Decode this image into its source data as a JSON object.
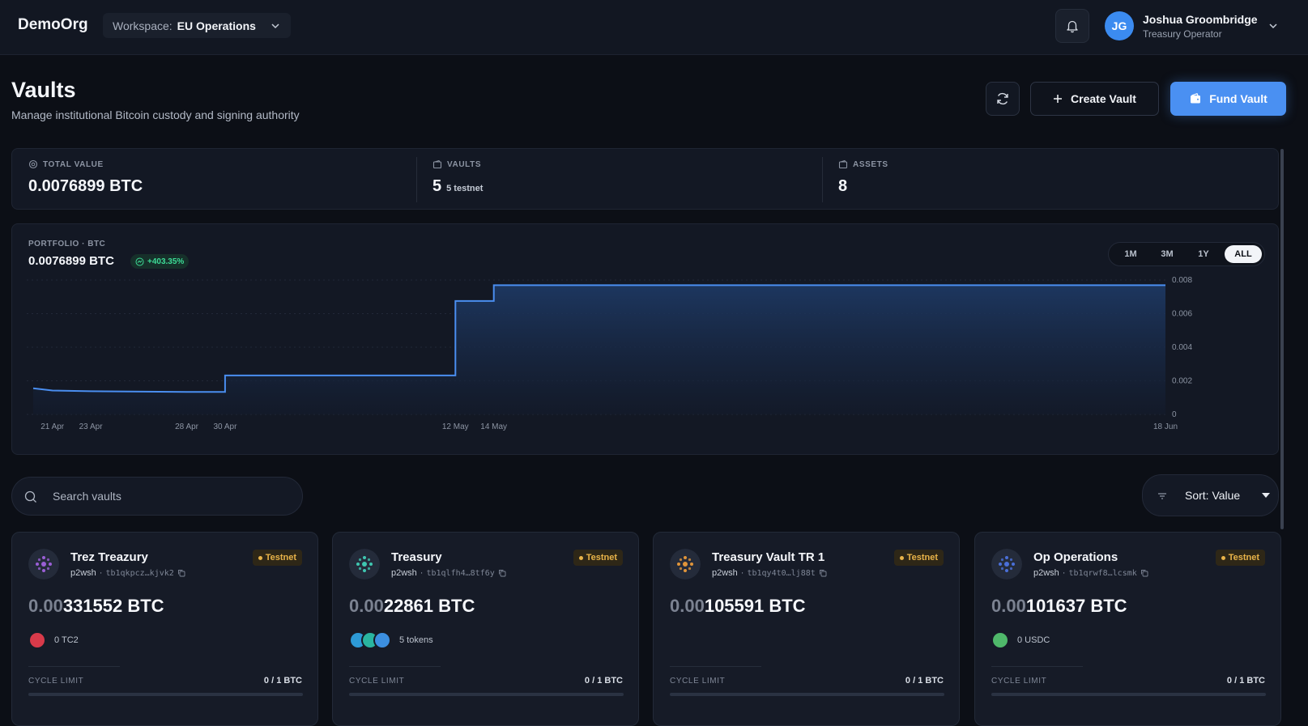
{
  "topbar": {
    "brand": "DemoOrg",
    "workspace_label": "Workspace:",
    "workspace_value": "EU Operations",
    "user": {
      "initials": "JG",
      "name": "Joshua Groombridge",
      "role": "Treasury Operator"
    }
  },
  "header": {
    "title": "Vaults",
    "subtitle": "Manage institutional Bitcoin custody and signing authority",
    "create_label": "Create Vault",
    "fund_label": "Fund Vault"
  },
  "stats": [
    {
      "label": "TOTAL VALUE",
      "value": "0.0076899 BTC",
      "note": ""
    },
    {
      "label": "VAULTS",
      "value": "5",
      "note": "5 testnet"
    },
    {
      "label": "ASSETS",
      "value": "8",
      "note": ""
    }
  ],
  "portfolio": {
    "label": "PORTFOLIO · BTC",
    "value": "0.0076899 BTC",
    "change": "+403.35%",
    "ranges": [
      "1M",
      "3M",
      "1Y",
      "ALL"
    ],
    "active_range": "ALL"
  },
  "chart_data": {
    "type": "area",
    "title": "",
    "x_ticks": [
      "21 Apr",
      "23 Apr",
      "28 Apr",
      "30 Apr",
      "12 May",
      "14 May",
      "18 Jun"
    ],
    "y_ticks": [
      "0.008",
      "0.006",
      "0.004",
      "0.002",
      "0"
    ],
    "ylim": [
      0,
      0.008
    ],
    "grid": true,
    "line_color": "#4a8ef0",
    "series": [
      {
        "step": true,
        "points": [
          [
            "20 Apr",
            0.00155
          ],
          [
            "21 Apr",
            0.00142
          ],
          [
            "23 Apr",
            0.00138
          ],
          [
            "28 Apr",
            0.00134
          ],
          [
            "30 Apr",
            0.00134
          ],
          [
            "30 Apr",
            0.00232
          ],
          [
            "12 May",
            0.00232
          ],
          [
            "12 May",
            0.00315
          ],
          [
            "12 May",
            0.00675
          ],
          [
            "14 May",
            0.00675
          ],
          [
            "14 May",
            0.00769
          ],
          [
            "18 Jun",
            0.00769
          ]
        ]
      }
    ]
  },
  "search": {
    "placeholder": "Search vaults"
  },
  "sort": {
    "label": "Sort: Value"
  },
  "vaults": [
    {
      "name": "Trez Treazury",
      "type": "p2wsh",
      "address": "tb1qkpcz…kjvk2",
      "badge": "Testnet",
      "balance_dim": "0.00",
      "balance_bright": "331552 BTC",
      "tokens_text": "0 TC2",
      "cycle_label": "CYCLE LIMIT",
      "cycle_value": "0 / 1 BTC",
      "cycle_used": 0,
      "icon_color": "#9a5fd6",
      "token_colors": [
        "#d83a4a"
      ]
    },
    {
      "name": "Treasury",
      "type": "p2wsh",
      "address": "tb1qlfh4…8tf6y",
      "badge": "Testnet",
      "balance_dim": "0.00",
      "balance_bright": "22861 BTC",
      "tokens_text": "5 tokens",
      "cycle_label": "CYCLE LIMIT",
      "cycle_value": "0 / 1 BTC",
      "cycle_used": 0,
      "icon_color": "#3fc6b0",
      "token_colors": [
        "#2d9ad6",
        "#2ab5a0",
        "#3c8fe0"
      ]
    },
    {
      "name": "Treasury Vault TR 1",
      "type": "p2wsh",
      "address": "tb1qy4t0…lj88t",
      "badge": "Testnet",
      "balance_dim": "0.00",
      "balance_bright": "105591 BTC",
      "tokens_text": "",
      "cycle_label": "CYCLE LIMIT",
      "cycle_value": "0 / 1 BTC",
      "cycle_used": 0,
      "icon_color": "#e0953a",
      "token_colors": []
    },
    {
      "name": "Op Operations",
      "type": "p2wsh",
      "address": "tb1qrwf8…lcsmk",
      "badge": "Testnet",
      "balance_dim": "0.00",
      "balance_bright": "101637 BTC",
      "tokens_text": "0 USDC",
      "cycle_label": "CYCLE LIMIT",
      "cycle_value": "0 / 1 BTC",
      "cycle_used": 0,
      "icon_color": "#4a6fd8",
      "token_colors": [
        "#4fb86a"
      ]
    }
  ]
}
